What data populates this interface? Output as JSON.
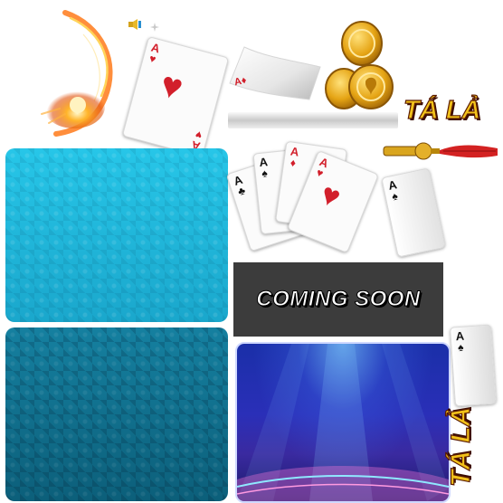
{
  "game_title": "TÁ LẢ",
  "coming_soon": "COMING SOON",
  "ace_rank": "A",
  "suits": {
    "heart": "♥",
    "diamond": "♦",
    "spade": "♠",
    "club": "♣"
  },
  "colors": {
    "panel_light": "#1bb8dc",
    "panel_dark": "#0f6b86",
    "coming_soon_bg": "#3c3c3c",
    "title_gold": "#f2c21b",
    "card_red": "#d21f2b",
    "stage_blue": "#2236b8"
  },
  "icons": [
    "fire-comet-icon",
    "speaker-icon",
    "gold-coins-icon",
    "golden-tassel-icon"
  ]
}
